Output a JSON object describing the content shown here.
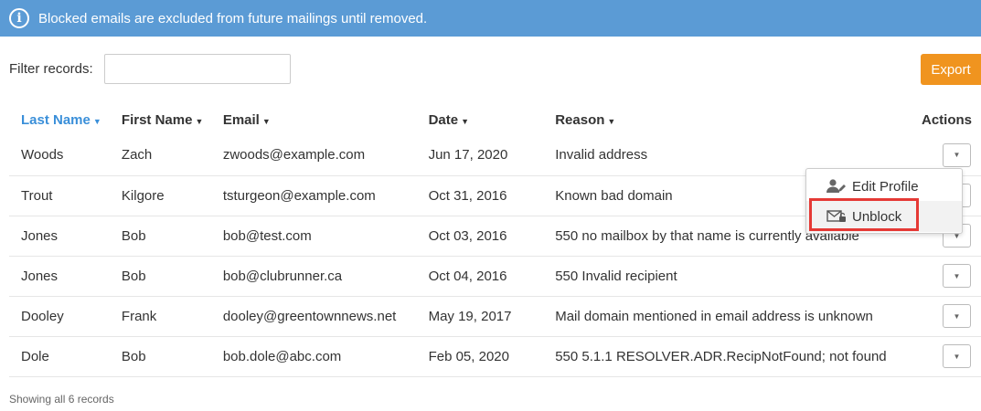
{
  "banner": {
    "icon": "info-icon",
    "text": "Blocked emails are excluded from future mailings until removed."
  },
  "filter": {
    "label": "Filter records:",
    "value": "",
    "placeholder": ""
  },
  "export_label": "Export",
  "table": {
    "columns": [
      {
        "label": "Last Name",
        "sorted": true
      },
      {
        "label": "First Name"
      },
      {
        "label": "Email"
      },
      {
        "label": "Date"
      },
      {
        "label": "Reason"
      },
      {
        "label": "Actions"
      }
    ],
    "rows": [
      {
        "last": "Woods",
        "first": "Zach",
        "email": "zwoods@example.com",
        "date": "Jun 17, 2020",
        "reason": "Invalid address"
      },
      {
        "last": "Trout",
        "first": "Kilgore",
        "email": "tsturgeon@example.com",
        "date": "Oct 31, 2016",
        "reason": "Known bad domain"
      },
      {
        "last": "Jones",
        "first": "Bob",
        "email": "bob@test.com",
        "date": "Oct 03, 2016",
        "reason": "550 no mailbox by that name is currently available"
      },
      {
        "last": "Jones",
        "first": "Bob",
        "email": "bob@clubrunner.ca",
        "date": "Oct 04, 2016",
        "reason": "550 Invalid recipient"
      },
      {
        "last": "Dooley",
        "first": "Frank",
        "email": "dooley@greentownnews.net",
        "date": "May 19, 2017",
        "reason": "Mail domain mentioned in email address is unknown"
      },
      {
        "last": "Dole",
        "first": "Bob",
        "email": "bob.dole@abc.com",
        "date": "Feb 05, 2020",
        "reason": "550 5.1.1 RESOLVER.ADR.RecipNotFound; not found"
      }
    ]
  },
  "dropdown": {
    "items": [
      {
        "label": "Edit Profile",
        "icon": "user-edit-icon"
      },
      {
        "label": "Unblock",
        "icon": "envelope-unlock-icon",
        "highlighted": true
      }
    ]
  },
  "footer": {
    "text": "Showing all 6 records"
  },
  "colors": {
    "banner": "#5b9bd5",
    "export": "#f0941f",
    "sorted_header": "#3a8fd9",
    "highlight": "#e53935"
  }
}
